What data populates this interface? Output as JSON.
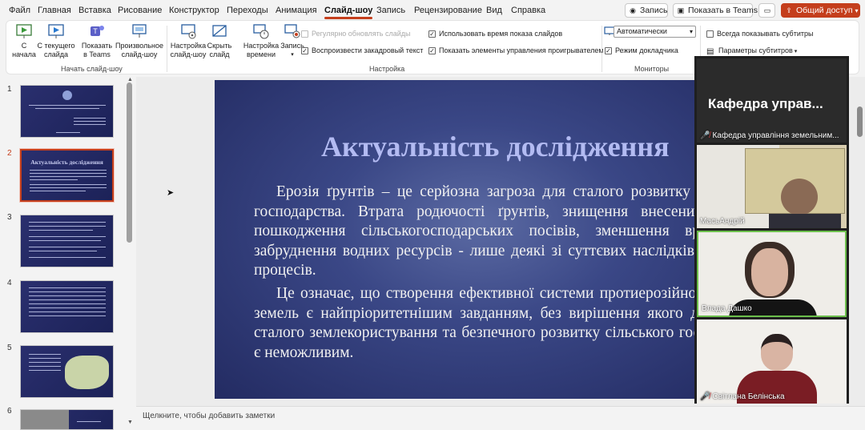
{
  "menu": {
    "items": [
      "Файл",
      "Главная",
      "Вставка",
      "Рисование",
      "Конструктор",
      "Переходы",
      "Анимация",
      "Слайд-шоу",
      "Запись",
      "Рецензирование",
      "Вид",
      "Справка"
    ],
    "active": "Слайд-шоу",
    "record_btn": "Запись",
    "teams_btn": "Показать в Teams",
    "share_btn": "Общий доступ"
  },
  "ribbon": {
    "from_start": "С начала",
    "from_current": "С текущего слайда",
    "present_teams": "Показать в Teams",
    "custom_show": "Произвольное слайд-шоу",
    "group_start": "Начать слайд-шоу",
    "setup_show": "Настройка слайд-шоу",
    "hide_slide": "Скрыть слайд",
    "rehearse": "Настройка времени",
    "record": "Запись",
    "chk_update": "Регулярно обновлять слайды",
    "chk_narration": "Воспроизвести закадровый текст",
    "chk_timings": "Использовать время показа слайдов",
    "chk_controls": "Показать элементы управления проигрывателем",
    "group_setup": "Настройка",
    "monitor_value": "Автоматически",
    "presenter_view": "Режим докладчика",
    "group_monitors": "Мониторы",
    "always_subtitles": "Всегда показывать субтитры",
    "subtitle_settings": "Параметры субтитров"
  },
  "thumbs": {
    "numbers": [
      "1",
      "2",
      "3",
      "4",
      "5",
      "6"
    ],
    "slide2_title": "Актуальність дослідження"
  },
  "slide": {
    "title": "Актуальність дослідження",
    "para1": "Ерозія ґрунтів – це серйозна загроза для сталого розвитку сільського господарства. Втрата родючості ґрунтів, знищення внесених добрив, пошкодження сільськогосподарських посівів, зменшення врожаїв та забруднення водних ресурсів - лише деякі зі суттєвих наслідків ерозійних процесів.",
    "para2": "Це означає, що створення ефективної системи протиерозійного захисту земель є найпріоритетнішим завданням, без вирішення якого досягнення сталого землекористування та безпечного розвитку сільського господарства є неможливим."
  },
  "notes_placeholder": "Щелкните, чтобы добавить заметки",
  "participants": {
    "room_title": "Кафедра управ...",
    "room_name": "Кафедра управління земельним...",
    "p1": "МасьАндрій",
    "p2": "Влада Дашко",
    "p3": "Світлана Белінська"
  },
  "colors": {
    "accent": "#c43e1c",
    "slide_bg": "#2e3a78",
    "slide_title": "#b3bbf2"
  }
}
